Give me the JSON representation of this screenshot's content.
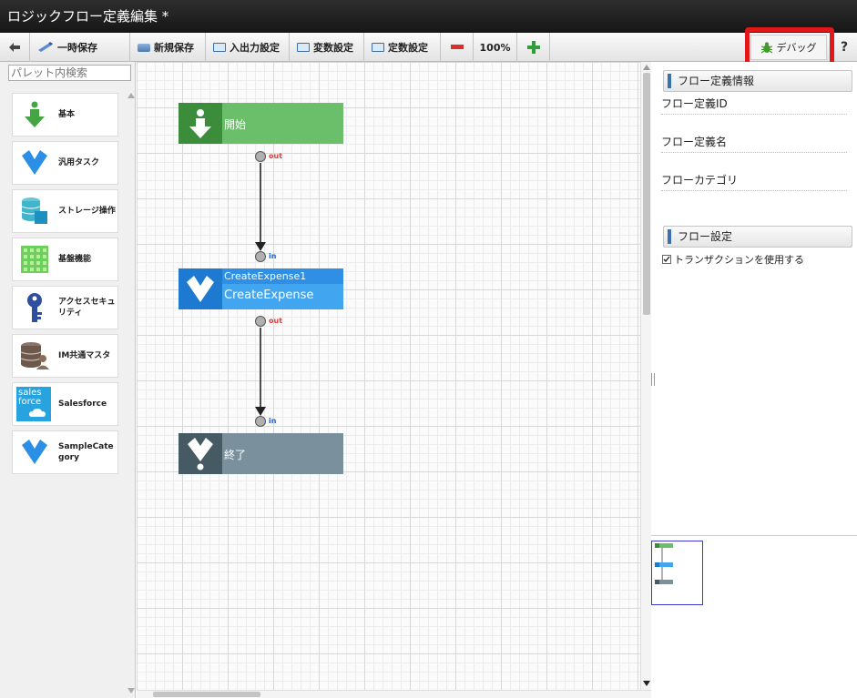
{
  "window": {
    "title": "ロジックフロー定義編集 *"
  },
  "toolbar": {
    "back_icon": "arrow-left-icon",
    "temp_save": "一時保存",
    "new_save": "新規保存",
    "io_settings": "入出力設定",
    "variable_settings": "変数設定",
    "constant_settings": "定数設定",
    "zoom_out_icon": "minus-icon",
    "zoom": "100%",
    "zoom_in_icon": "plus-icon",
    "debug": "デバッグ",
    "help": "?"
  },
  "palette": {
    "search_placeholder": "パレット内検索",
    "items": [
      {
        "label": "基本",
        "icon": "basic-flow-icon"
      },
      {
        "label": "汎用タスク",
        "icon": "generic-task-icon"
      },
      {
        "label": "ストレージ操作",
        "icon": "storage-icon"
      },
      {
        "label": "基盤機能",
        "icon": "platform-icon"
      },
      {
        "label": "アクセスセキュリティ",
        "icon": "key-icon"
      },
      {
        "label": "IM共通マスタ",
        "icon": "common-master-icon"
      },
      {
        "label": "Salesforce",
        "icon": "salesforce-icon",
        "icon_text_1": "sales",
        "icon_text_2": "force"
      },
      {
        "label": "SampleCategory",
        "icon": "sample-category-icon"
      }
    ]
  },
  "flow": {
    "start": {
      "label": "開始",
      "port_out": "out"
    },
    "task": {
      "id": "CreateExpense1",
      "name": "CreateExpense",
      "port_in": "in",
      "port_out": "out"
    },
    "end": {
      "label": "終了",
      "port_in": "in"
    }
  },
  "properties": {
    "flow_info_header": "フロー定義情報",
    "flow_id_label": "フロー定義ID",
    "flow_name_label": "フロー定義名",
    "flow_category_label": "フローカテゴリ",
    "flow_settings_header": "フロー設定",
    "transaction_label": "トランザクションを使用する",
    "transaction_checked": true
  },
  "colors": {
    "start_node": "#6cbf6a",
    "start_icon_bg": "#3b8c3b",
    "task_node": "#42a5f0",
    "task_icon_bg": "#1e7ad0",
    "end_node": "#7a919d",
    "end_icon_bg": "#465a64",
    "highlight": "#e11818",
    "out_port_text": "#e53935",
    "in_port_text": "#1e62d0"
  }
}
